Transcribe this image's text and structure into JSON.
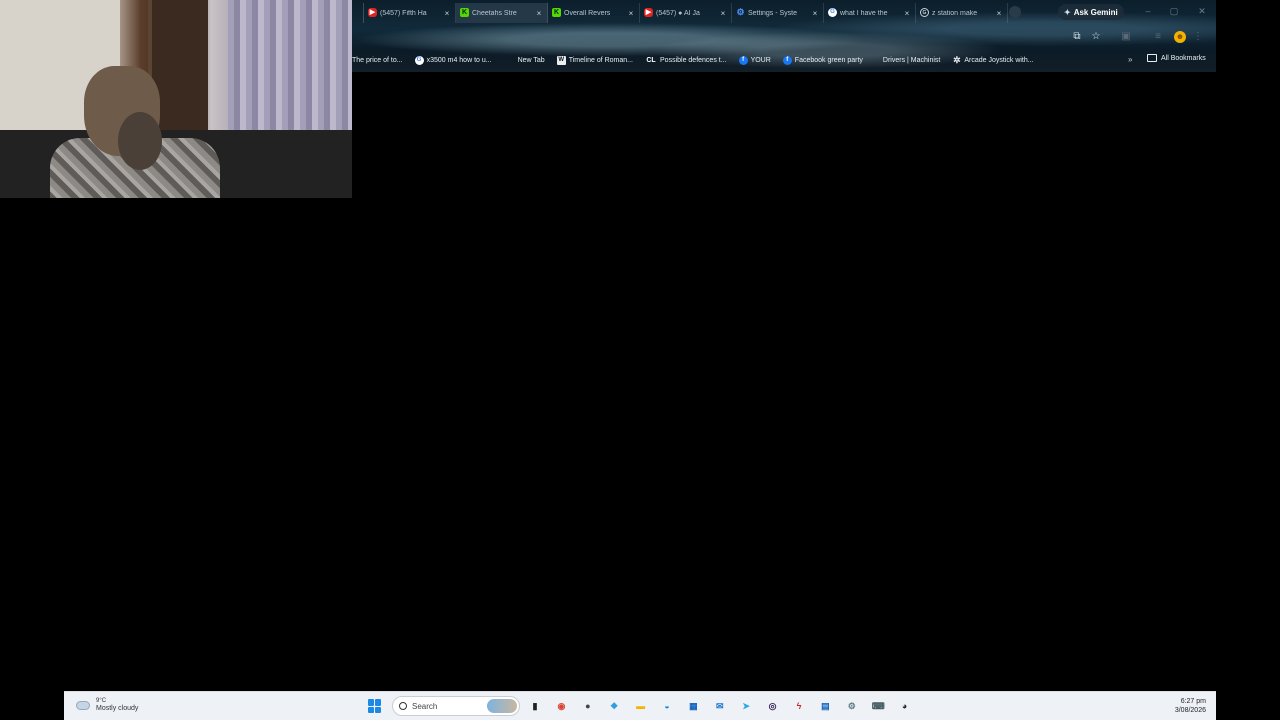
{
  "browser": {
    "tabs": [
      {
        "title": "",
        "favicon": "partial-tab"
      },
      {
        "title": "(5457) Fifth Ha",
        "favicon": "youtube-icon"
      },
      {
        "title": "Cheetahs Stre",
        "favicon": "kick-icon",
        "active": true
      },
      {
        "title": "Overall Revers",
        "favicon": "kick-icon"
      },
      {
        "title": "(5457) ● AI Ja",
        "favicon": "youtube-icon"
      },
      {
        "title": "Settings - Syste",
        "favicon": "gear-icon"
      },
      {
        "title": "what I have the",
        "favicon": "google-icon"
      },
      {
        "title": "z station make",
        "favicon": "google-search-icon"
      }
    ],
    "tab_close": "×",
    "ask_gemini": "Ask Gemini",
    "bookmarks": [
      {
        "label": "The price of to...",
        "icon": "none"
      },
      {
        "label": "x3500 m4 how to u...",
        "icon": "google-icon"
      },
      {
        "label": "New Tab",
        "icon": "none"
      },
      {
        "label": "Timeline of Roman...",
        "icon": "wikipedia-icon"
      },
      {
        "label": "Possible defences t...",
        "icon": "cl-icon"
      },
      {
        "label": "YOUR",
        "icon": "facebook-icon"
      },
      {
        "label": "Facebook green party",
        "icon": "facebook-icon"
      },
      {
        "label": "Drivers | Machinist",
        "icon": "none"
      },
      {
        "label": "Arcade Joystick with...",
        "icon": "joystick-icon"
      }
    ],
    "bookmarks_more": "»",
    "all_bookmarks": "All Bookmarks"
  },
  "taskbar": {
    "weather_temp": "9°C",
    "weather_condition": "Mostly cloudy",
    "search_placeholder": "Search",
    "apps": [
      {
        "name": "file-explorer-icon",
        "color": "#222222",
        "glyph": "▮"
      },
      {
        "name": "chrome-icon",
        "color": "#db4437",
        "glyph": "◉"
      },
      {
        "name": "app-badge-icon",
        "color": "#444444",
        "glyph": "●"
      },
      {
        "name": "copilot-icon",
        "color": "#2f9be0",
        "glyph": "❖"
      },
      {
        "name": "folder-icon",
        "color": "#f4b400",
        "glyph": "▬"
      },
      {
        "name": "edge-icon",
        "color": "#0b84d6",
        "glyph": "◒"
      },
      {
        "name": "store-icon",
        "color": "#1565c0",
        "glyph": "▦"
      },
      {
        "name": "outlook-icon",
        "color": "#1976d2",
        "glyph": "✉"
      },
      {
        "name": "telegram-icon",
        "color": "#29a9eb",
        "glyph": "➤"
      },
      {
        "name": "obs-icon",
        "color": "#3b2a5e",
        "glyph": "◎"
      },
      {
        "name": "red-app-icon",
        "color": "#c62828",
        "glyph": "ϟ"
      },
      {
        "name": "blue-app-icon",
        "color": "#1565c0",
        "glyph": "▤"
      },
      {
        "name": "settings-icon",
        "color": "#607d8b",
        "glyph": "⚙"
      },
      {
        "name": "gamepad-icon",
        "color": "#455a64",
        "glyph": "⌨"
      },
      {
        "name": "steam-icon",
        "color": "#1b2838",
        "glyph": "◕"
      }
    ],
    "time": "6:27 pm",
    "date": "3/08/2026"
  }
}
